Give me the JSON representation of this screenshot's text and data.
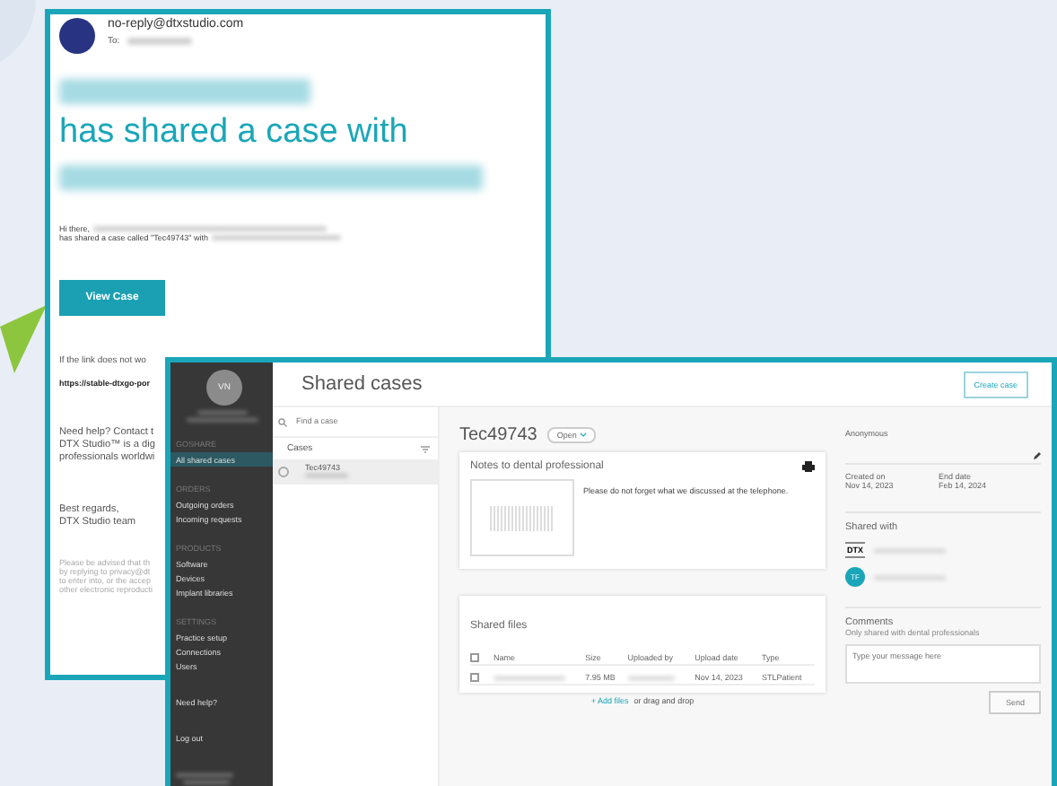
{
  "email": {
    "sender": "no-reply@dtxstudio.com",
    "to_label": "To:",
    "headline": "has shared a case with",
    "greeting": "Hi there,",
    "body": "has shared a case called \"Tec49743\" with",
    "button": "View Case",
    "paragraphs": [
      {
        "kind": "plain",
        "lines": [
          "If the link does not wo"
        ]
      },
      {
        "kind": "link",
        "lines": [
          "https://stable-dtxgo-por"
        ]
      },
      {
        "kind": "large",
        "lines": [
          "Need help? Contact t",
          "DTX Studio™ is a dig",
          "professionals worldwi"
        ]
      },
      {
        "kind": "large",
        "lines": [
          "Best regards,",
          "DTX Studio team"
        ]
      },
      {
        "kind": "small",
        "lines": [
          "Please be advised that th",
          "by replying to privacy@dt",
          "to enter into, or the accep",
          "other electronic reproducti"
        ]
      }
    ]
  },
  "app": {
    "avatar": "VN",
    "title": "Shared cases",
    "create_button": "Create case",
    "sidebar": [
      {
        "heading": "GOSHARE",
        "items": [
          {
            "label": "All shared cases",
            "selected": true
          }
        ]
      },
      {
        "heading": "ORDERS",
        "items": [
          {
            "label": "Outgoing orders",
            "selected": false
          },
          {
            "label": "Incoming requests",
            "selected": false
          }
        ]
      },
      {
        "heading": "PRODUCTS",
        "items": [
          {
            "label": "Software",
            "selected": false
          },
          {
            "label": "Devices",
            "selected": false
          },
          {
            "label": "Implant libraries",
            "selected": false
          }
        ]
      },
      {
        "heading": "SETTINGS",
        "items": [
          {
            "label": "Practice setup",
            "selected": false
          },
          {
            "label": "Connections",
            "selected": false
          },
          {
            "label": "Users",
            "selected": false
          }
        ]
      }
    ],
    "help": "Need help?",
    "logout": "Log out",
    "search": {
      "placeholder": "Find a case"
    },
    "cases_label": "Cases",
    "cases": [
      {
        "name": "Tec49743",
        "selected": true
      }
    ],
    "case": {
      "name": "Tec49743",
      "status": "Open",
      "notes_title": "Notes to dental professional",
      "notes": "Please do not forget what we discussed at the telephone.",
      "owner": "Anonymous",
      "created_label": "Created on",
      "created": "Nov 14, 2023",
      "end_label": "End date",
      "end": "Feb 14, 2024",
      "shared_with": "Shared with",
      "shares": [
        {
          "kind": "logo",
          "badge": "DTX"
        },
        {
          "kind": "initials",
          "badge": "TF"
        }
      ],
      "files_title": "Shared files",
      "select_all": {
        "checked": false
      },
      "columns": [
        "Name",
        "Size",
        "Uploaded by",
        "Upload date",
        "Type"
      ],
      "files": [
        {
          "checked": false,
          "size": "7.95 MB",
          "date": "Nov 14, 2023",
          "type": "STLPatient"
        }
      ],
      "add_files": "+ Add files",
      "drop": "or drag and drop",
      "comments_title": "Comments",
      "comments_note": "Only shared with dental professionals",
      "comment_placeholder": "Type your message here",
      "send": "Send"
    }
  }
}
